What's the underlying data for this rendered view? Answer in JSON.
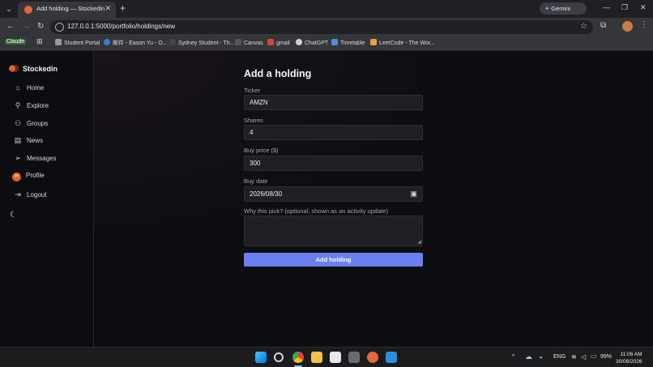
{
  "browser": {
    "tab_title": "Add holding — Stockedin",
    "new_tab_symbol": "+",
    "gemini_label": "Gemini",
    "url": "127.0.0.1:5000/portfolio/holdings/new",
    "bookmarks": [
      "Claude",
      "Student Portal",
      "邮件 - Eason Yu - O...",
      "Sydney Student - Th...",
      "Canvas",
      "gmail",
      "ChatGPT",
      "Timetable",
      "LeetCode - The Wor..."
    ]
  },
  "sidebar": {
    "brand": "Stockedin",
    "items": [
      {
        "label": "Home",
        "icon": "home-icon"
      },
      {
        "label": "Explore",
        "icon": "search-icon"
      },
      {
        "label": "Groups",
        "icon": "users-icon"
      },
      {
        "label": "News",
        "icon": "newspaper-icon"
      },
      {
        "label": "Messages",
        "icon": "send-icon"
      },
      {
        "label": "Profile",
        "icon": "avatar"
      },
      {
        "label": "Logout",
        "icon": "logout-icon"
      }
    ],
    "profile_initial": "H"
  },
  "form": {
    "title": "Add a holding",
    "ticker_label": "Ticker",
    "ticker_value": "AMZN",
    "shares_label": "Shares",
    "shares_value": "4",
    "price_label": "Buy price ($)",
    "price_value": "300",
    "date_label": "Buy date",
    "date_value": "2026/08/30",
    "reason_label": "Why this pick? (optional, shown as an activity update)",
    "reason_value": "",
    "submit_label": "Add holding"
  },
  "taskbar": {
    "language": "ENG",
    "battery": "99%",
    "time": "11:06 AM",
    "date": "30/08/2026"
  },
  "colors": {
    "accent": "#6b7ff0",
    "brand": "#e0622d",
    "background": "#0d0e12"
  }
}
